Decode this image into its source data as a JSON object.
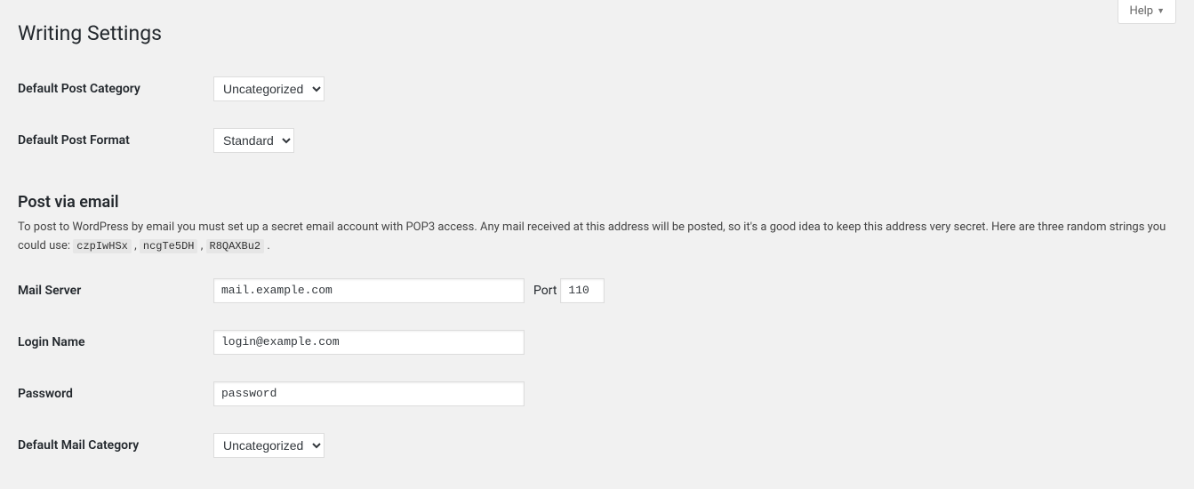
{
  "help": {
    "label": "Help"
  },
  "page_title": "Writing Settings",
  "fields": {
    "default_post_category": {
      "label": "Default Post Category",
      "value": "Uncategorized"
    },
    "default_post_format": {
      "label": "Default Post Format",
      "value": "Standard"
    }
  },
  "post_via_email": {
    "heading": "Post via email",
    "description_pre": "To post to WordPress by email you must set up a secret email account with POP3 access. Any mail received at this address will be posted, so it's a good idea to keep this address very secret. Here are three random strings you could use: ",
    "random_strings": [
      "czpIwHSx",
      "ncgTe5DH",
      "R8QAXBu2"
    ],
    "mail_server": {
      "label": "Mail Server",
      "value": "mail.example.com",
      "port_label": "Port",
      "port_value": "110"
    },
    "login_name": {
      "label": "Login Name",
      "value": "login@example.com"
    },
    "password": {
      "label": "Password",
      "value": "password"
    },
    "default_mail_category": {
      "label": "Default Mail Category",
      "value": "Uncategorized"
    }
  }
}
